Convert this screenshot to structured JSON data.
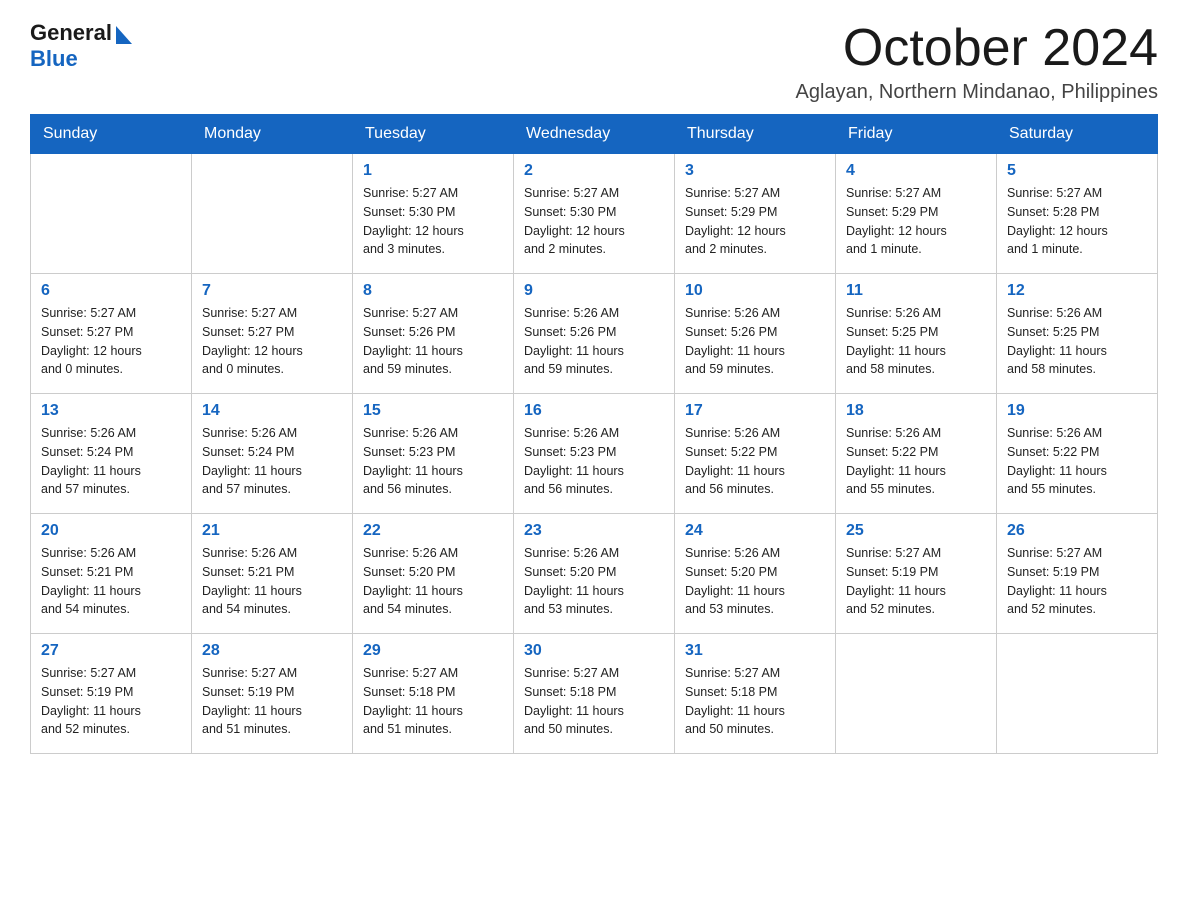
{
  "header": {
    "logo_general": "General",
    "logo_blue": "Blue",
    "month_title": "October 2024",
    "location": "Aglayan, Northern Mindanao, Philippines"
  },
  "calendar": {
    "weekdays": [
      "Sunday",
      "Monday",
      "Tuesday",
      "Wednesday",
      "Thursday",
      "Friday",
      "Saturday"
    ],
    "weeks": [
      [
        {
          "day": "",
          "info": ""
        },
        {
          "day": "",
          "info": ""
        },
        {
          "day": "1",
          "info": "Sunrise: 5:27 AM\nSunset: 5:30 PM\nDaylight: 12 hours\nand 3 minutes."
        },
        {
          "day": "2",
          "info": "Sunrise: 5:27 AM\nSunset: 5:30 PM\nDaylight: 12 hours\nand 2 minutes."
        },
        {
          "day": "3",
          "info": "Sunrise: 5:27 AM\nSunset: 5:29 PM\nDaylight: 12 hours\nand 2 minutes."
        },
        {
          "day": "4",
          "info": "Sunrise: 5:27 AM\nSunset: 5:29 PM\nDaylight: 12 hours\nand 1 minute."
        },
        {
          "day": "5",
          "info": "Sunrise: 5:27 AM\nSunset: 5:28 PM\nDaylight: 12 hours\nand 1 minute."
        }
      ],
      [
        {
          "day": "6",
          "info": "Sunrise: 5:27 AM\nSunset: 5:27 PM\nDaylight: 12 hours\nand 0 minutes."
        },
        {
          "day": "7",
          "info": "Sunrise: 5:27 AM\nSunset: 5:27 PM\nDaylight: 12 hours\nand 0 minutes."
        },
        {
          "day": "8",
          "info": "Sunrise: 5:27 AM\nSunset: 5:26 PM\nDaylight: 11 hours\nand 59 minutes."
        },
        {
          "day": "9",
          "info": "Sunrise: 5:26 AM\nSunset: 5:26 PM\nDaylight: 11 hours\nand 59 minutes."
        },
        {
          "day": "10",
          "info": "Sunrise: 5:26 AM\nSunset: 5:26 PM\nDaylight: 11 hours\nand 59 minutes."
        },
        {
          "day": "11",
          "info": "Sunrise: 5:26 AM\nSunset: 5:25 PM\nDaylight: 11 hours\nand 58 minutes."
        },
        {
          "day": "12",
          "info": "Sunrise: 5:26 AM\nSunset: 5:25 PM\nDaylight: 11 hours\nand 58 minutes."
        }
      ],
      [
        {
          "day": "13",
          "info": "Sunrise: 5:26 AM\nSunset: 5:24 PM\nDaylight: 11 hours\nand 57 minutes."
        },
        {
          "day": "14",
          "info": "Sunrise: 5:26 AM\nSunset: 5:24 PM\nDaylight: 11 hours\nand 57 minutes."
        },
        {
          "day": "15",
          "info": "Sunrise: 5:26 AM\nSunset: 5:23 PM\nDaylight: 11 hours\nand 56 minutes."
        },
        {
          "day": "16",
          "info": "Sunrise: 5:26 AM\nSunset: 5:23 PM\nDaylight: 11 hours\nand 56 minutes."
        },
        {
          "day": "17",
          "info": "Sunrise: 5:26 AM\nSunset: 5:22 PM\nDaylight: 11 hours\nand 56 minutes."
        },
        {
          "day": "18",
          "info": "Sunrise: 5:26 AM\nSunset: 5:22 PM\nDaylight: 11 hours\nand 55 minutes."
        },
        {
          "day": "19",
          "info": "Sunrise: 5:26 AM\nSunset: 5:22 PM\nDaylight: 11 hours\nand 55 minutes."
        }
      ],
      [
        {
          "day": "20",
          "info": "Sunrise: 5:26 AM\nSunset: 5:21 PM\nDaylight: 11 hours\nand 54 minutes."
        },
        {
          "day": "21",
          "info": "Sunrise: 5:26 AM\nSunset: 5:21 PM\nDaylight: 11 hours\nand 54 minutes."
        },
        {
          "day": "22",
          "info": "Sunrise: 5:26 AM\nSunset: 5:20 PM\nDaylight: 11 hours\nand 54 minutes."
        },
        {
          "day": "23",
          "info": "Sunrise: 5:26 AM\nSunset: 5:20 PM\nDaylight: 11 hours\nand 53 minutes."
        },
        {
          "day": "24",
          "info": "Sunrise: 5:26 AM\nSunset: 5:20 PM\nDaylight: 11 hours\nand 53 minutes."
        },
        {
          "day": "25",
          "info": "Sunrise: 5:27 AM\nSunset: 5:19 PM\nDaylight: 11 hours\nand 52 minutes."
        },
        {
          "day": "26",
          "info": "Sunrise: 5:27 AM\nSunset: 5:19 PM\nDaylight: 11 hours\nand 52 minutes."
        }
      ],
      [
        {
          "day": "27",
          "info": "Sunrise: 5:27 AM\nSunset: 5:19 PM\nDaylight: 11 hours\nand 52 minutes."
        },
        {
          "day": "28",
          "info": "Sunrise: 5:27 AM\nSunset: 5:19 PM\nDaylight: 11 hours\nand 51 minutes."
        },
        {
          "day": "29",
          "info": "Sunrise: 5:27 AM\nSunset: 5:18 PM\nDaylight: 11 hours\nand 51 minutes."
        },
        {
          "day": "30",
          "info": "Sunrise: 5:27 AM\nSunset: 5:18 PM\nDaylight: 11 hours\nand 50 minutes."
        },
        {
          "day": "31",
          "info": "Sunrise: 5:27 AM\nSunset: 5:18 PM\nDaylight: 11 hours\nand 50 minutes."
        },
        {
          "day": "",
          "info": ""
        },
        {
          "day": "",
          "info": ""
        }
      ]
    ]
  }
}
